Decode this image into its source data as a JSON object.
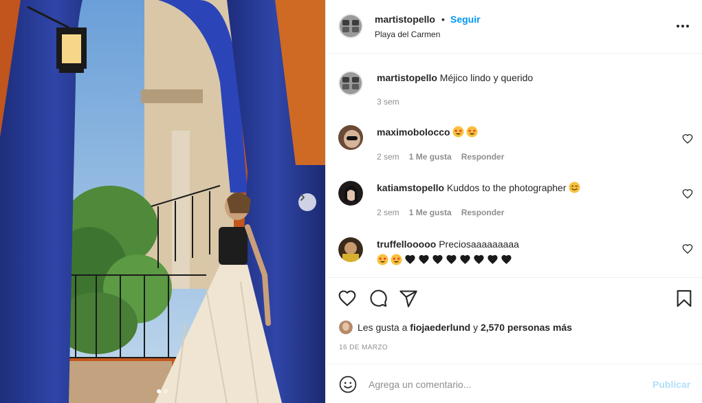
{
  "post": {
    "username": "martistopello",
    "separator": "•",
    "follow_label": "Seguir",
    "location": "Playa del Carmen",
    "more_icon": "more-horizontal-icon",
    "carousel": {
      "slides": 2,
      "active_slide": 1,
      "next_icon": "chevron-right-icon"
    }
  },
  "caption": {
    "username": "martistopello",
    "text": "Méjico lindo y querido",
    "time": "3 sem"
  },
  "comments": [
    {
      "username": "maximobolocco",
      "text": "",
      "emojis": [
        "star-struck",
        "star-struck"
      ],
      "time": "2 sem",
      "likes": "1 Me gusta",
      "reply": "Responder",
      "avatar_color": "#5b3b2b"
    },
    {
      "username": "katiamstopello",
      "text": "Kuddos to the photographer",
      "emojis": [
        "winking-face"
      ],
      "time": "2 sem",
      "likes": "1 Me gusta",
      "reply": "Responder",
      "avatar_color": "#1f1a1a"
    },
    {
      "username": "truffellooooo",
      "text": "Preciosaaaaaaaaa",
      "emojis": [
        "star-struck",
        "star-struck",
        "black-heart",
        "black-heart",
        "black-heart",
        "black-heart",
        "black-heart",
        "black-heart",
        "black-heart",
        "black-heart"
      ],
      "avatar_color": "#3a2a1a"
    }
  ],
  "actions": {
    "like_icon": "heart-icon",
    "comment_icon": "comment-icon",
    "share_icon": "send-icon",
    "save_icon": "bookmark-icon"
  },
  "likes": {
    "prefix": "Les gusta a",
    "liker": "fiojaederlund",
    "connector": "y",
    "others": "2,570 personas más"
  },
  "date": "16 DE MARZO",
  "add_comment": {
    "placeholder": "Agrega un comentario...",
    "post_label": "Publicar"
  },
  "colors": {
    "accent": "#0095f6",
    "post_disabled": "#b2dffc",
    "muted": "#8e8e8e",
    "text": "#262626"
  }
}
